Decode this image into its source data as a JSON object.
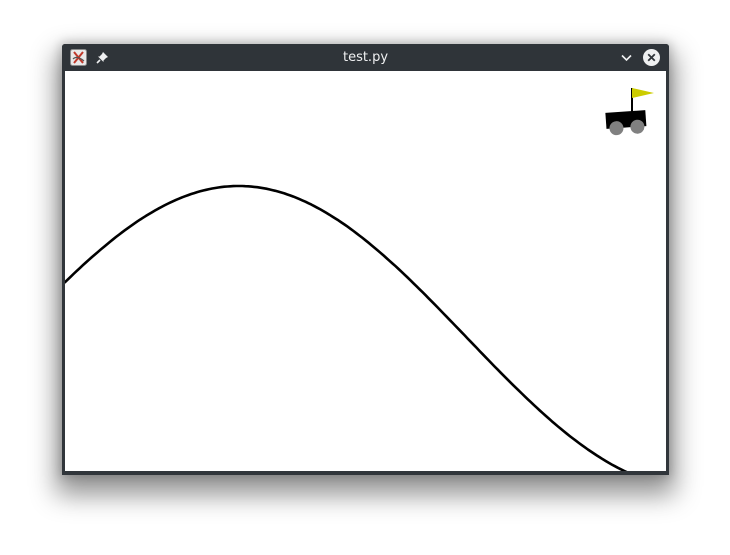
{
  "window": {
    "title": "test.py"
  },
  "titlebar_icons": {
    "app": "app-icon",
    "pin": "pin-icon",
    "minimize": "chevron-down-icon",
    "close": "close-icon"
  },
  "scene": {
    "background_color": "#ffffff",
    "track_color": "#000000",
    "car_color": "#000000",
    "wheel_color": "#808080",
    "flag_color": "#cccc00",
    "flagpole_color": "#000000"
  }
}
